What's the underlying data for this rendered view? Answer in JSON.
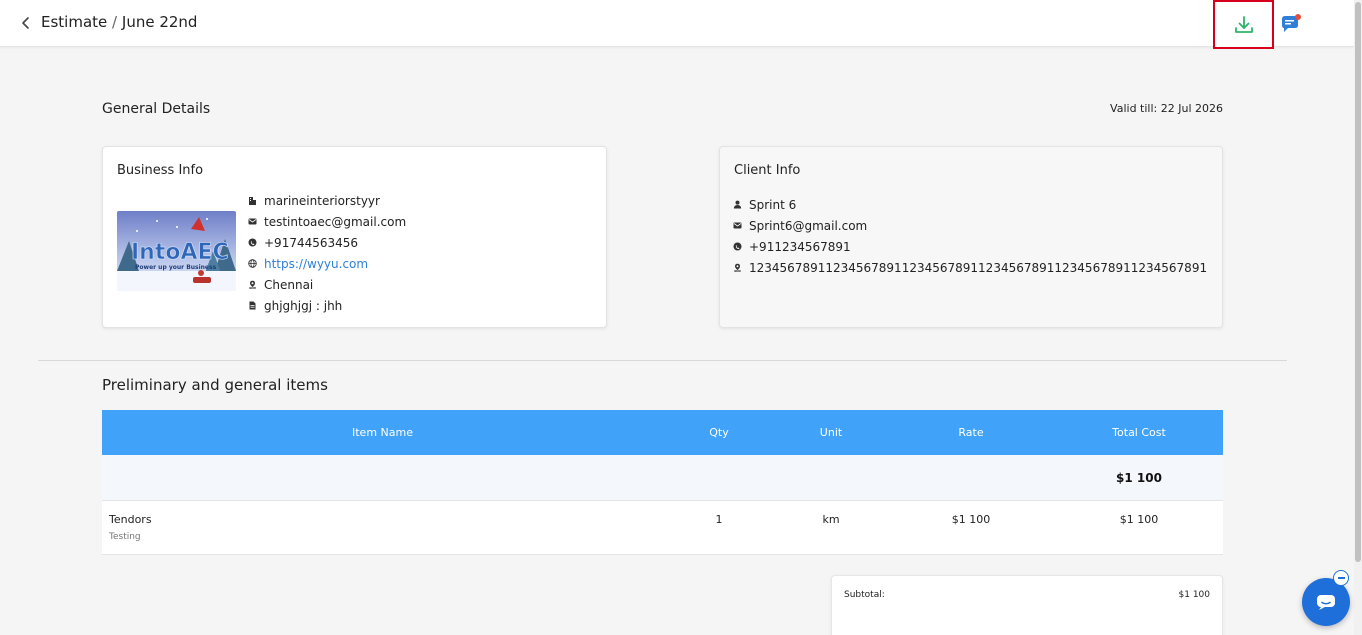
{
  "header": {
    "title_main": "Estimate",
    "title_sep": "/",
    "title_sub": "June 22nd",
    "back_icon": "chevron-left-icon",
    "download_icon": "download-icon",
    "chat_icon": "chat-bubble-icon",
    "download_color": "#2db36b",
    "highlight_color": "#d6001c"
  },
  "general": {
    "title": "General Details",
    "valid_till": "Valid till: 22 Jul 2026"
  },
  "business": {
    "title": "Business Info",
    "logo_text": "IntoAEC",
    "logo_tagline": "Power up your Business",
    "rows": [
      {
        "icon": "building-icon",
        "text": "marineinteriorstyyr"
      },
      {
        "icon": "mail-icon",
        "text": "testintoaec@gmail.com"
      },
      {
        "icon": "phone-icon",
        "text": "+91744563456"
      },
      {
        "icon": "globe-icon",
        "text": "https://wyyu.com"
      },
      {
        "icon": "location-icon",
        "text": "Chennai"
      },
      {
        "icon": "document-icon",
        "text": "ghjghjgj : jhh"
      }
    ]
  },
  "client": {
    "title": "Client Info",
    "rows": [
      {
        "icon": "user-icon",
        "text": "Sprint 6"
      },
      {
        "icon": "mail-icon",
        "text": "Sprint6@gmail.com"
      },
      {
        "icon": "phone-icon",
        "text": "+911234567891"
      },
      {
        "icon": "location-icon",
        "text": "123456789112345678911234567891123456789112345678911234567891"
      }
    ]
  },
  "section": {
    "title": "Preliminary and general items",
    "columns": [
      "Item Name",
      "Qty",
      "Unit",
      "Rate",
      "Total Cost"
    ],
    "section_total": "$1 100",
    "items": [
      {
        "name": "Tendors",
        "description": "Testing",
        "qty": "1",
        "unit": "km",
        "rate": "$1 100",
        "total": "$1 100"
      }
    ]
  },
  "summary": {
    "subtotal_label": "Subtotal:",
    "subtotal_value": "$1 100"
  },
  "colors": {
    "table_header": "#40a2f8",
    "link": "#2f7fd8",
    "fab": "#1e6fd9"
  }
}
